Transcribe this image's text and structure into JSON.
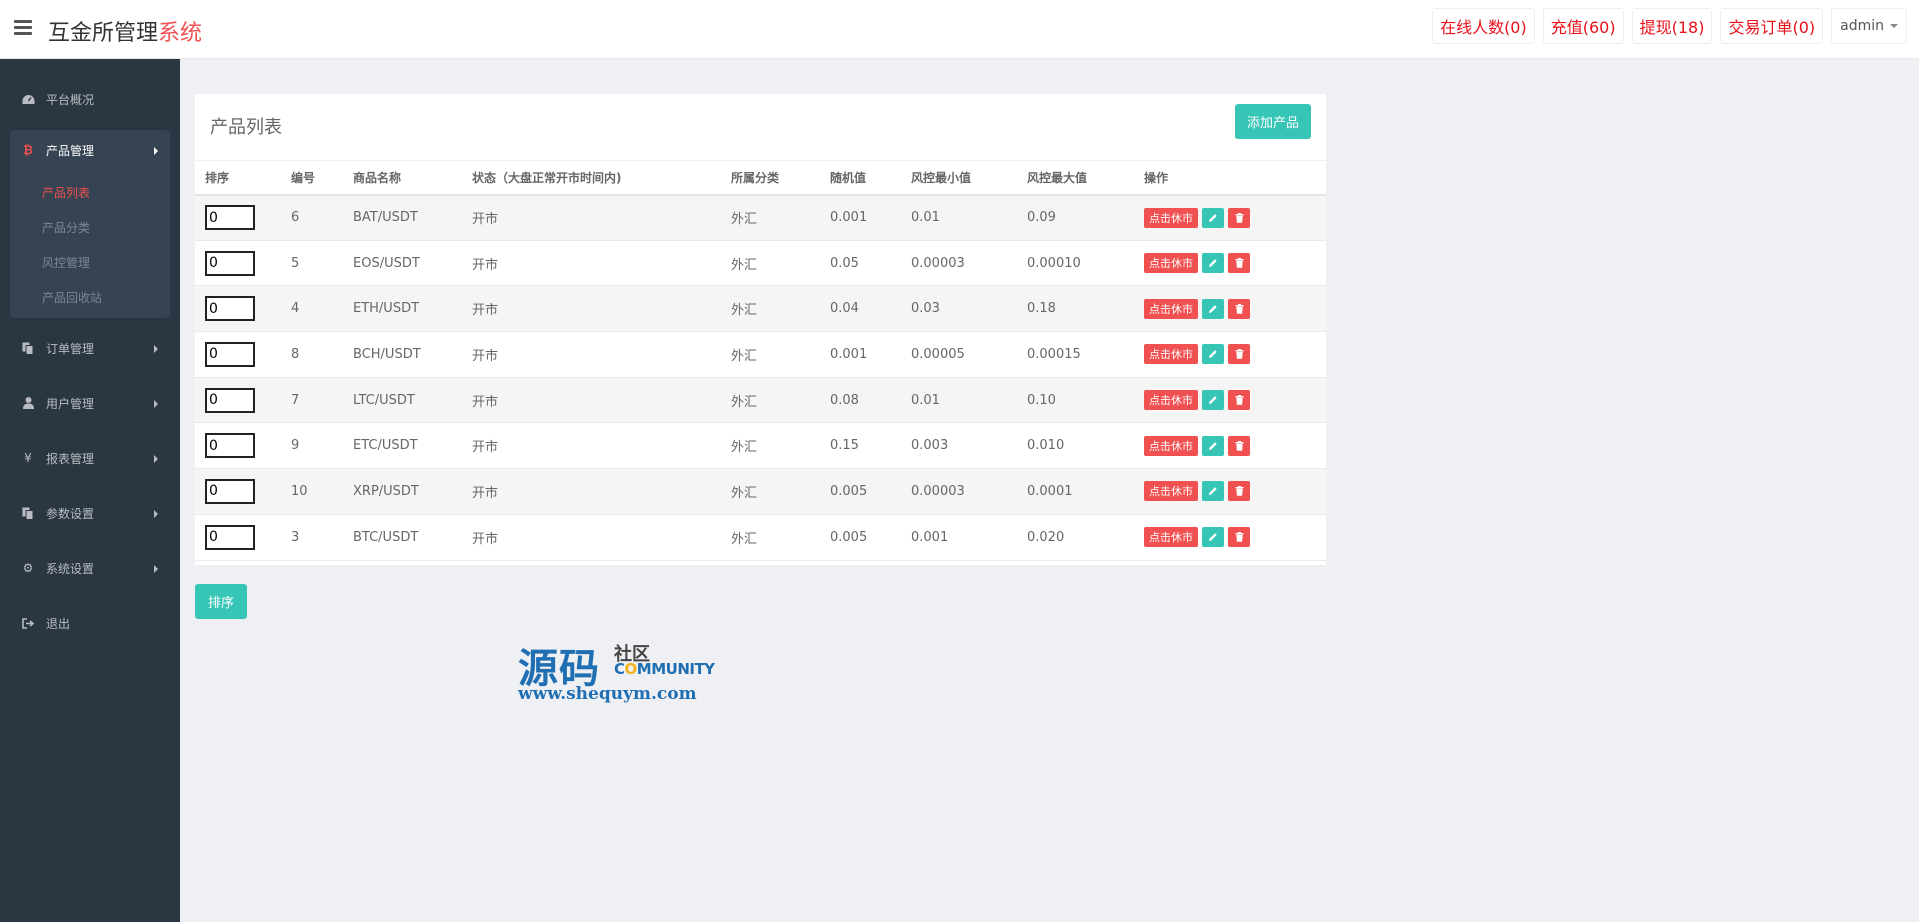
{
  "header": {
    "brand_main": "互金所管理",
    "brand_accent": "系统",
    "buttons": [
      "在线人数(0)",
      "充值(60)",
      "提现(18)",
      "交易订单(0)"
    ],
    "user": "admin"
  },
  "sidebar": {
    "items": [
      {
        "label": "平台概况",
        "icon": "dashboard-icon"
      },
      {
        "label": "产品管理",
        "icon": "bitcoin-icon"
      },
      {
        "label": "订单管理",
        "icon": "copy-icon"
      },
      {
        "label": "用户管理",
        "icon": "user-icon"
      },
      {
        "label": "报表管理",
        "icon": "yen-icon"
      },
      {
        "label": "参数设置",
        "icon": "copy-icon"
      },
      {
        "label": "系统设置",
        "icon": "gears-icon"
      },
      {
        "label": "退出",
        "icon": "sign-out-icon"
      }
    ],
    "sub_items": [
      "产品列表",
      "产品分类",
      "风控管理",
      "产品回收站"
    ]
  },
  "panel": {
    "title": "产品列表",
    "add_button": "添加产品",
    "columns": [
      "排序",
      "编号",
      "商品名称",
      "状态（大盘正常开市时间内)",
      "所属分类",
      "随机值",
      "风控最小值",
      "风控最大值",
      "操作"
    ],
    "rows": [
      {
        "sort": "0",
        "id": "6",
        "name": "BAT/USDT",
        "status": "开市",
        "category": "外汇",
        "random": "0.001",
        "min": "0.01",
        "max": "0.09"
      },
      {
        "sort": "0",
        "id": "5",
        "name": "EOS/USDT",
        "status": "开市",
        "category": "外汇",
        "random": "0.05",
        "min": "0.00003",
        "max": "0.00010"
      },
      {
        "sort": "0",
        "id": "4",
        "name": "ETH/USDT",
        "status": "开市",
        "category": "外汇",
        "random": "0.04",
        "min": "0.03",
        "max": "0.18"
      },
      {
        "sort": "0",
        "id": "8",
        "name": "BCH/USDT",
        "status": "开市",
        "category": "外汇",
        "random": "0.001",
        "min": "0.00005",
        "max": "0.00015"
      },
      {
        "sort": "0",
        "id": "7",
        "name": "LTC/USDT",
        "status": "开市",
        "category": "外汇",
        "random": "0.08",
        "min": "0.01",
        "max": "0.10"
      },
      {
        "sort": "0",
        "id": "9",
        "name": "ETC/USDT",
        "status": "开市",
        "category": "外汇",
        "random": "0.15",
        "min": "0.003",
        "max": "0.010"
      },
      {
        "sort": "0",
        "id": "10",
        "name": "XRP/USDT",
        "status": "开市",
        "category": "外汇",
        "random": "0.005",
        "min": "0.00003",
        "max": "0.0001"
      },
      {
        "sort": "0",
        "id": "3",
        "name": "BTC/USDT",
        "status": "开市",
        "category": "外汇",
        "random": "0.005",
        "min": "0.001",
        "max": "0.020"
      }
    ],
    "row_action": "点击休市",
    "sort_button": "排序"
  },
  "watermark": {
    "big": "源码",
    "small": "社区",
    "community_c": "C",
    "community_o": "O",
    "community_rest": "MMUNITY",
    "url": "www.shequym.com"
  },
  "colors": {
    "accent_red": "#f05050",
    "teal": "#37c6b6",
    "sidebar_bg": "#2b3643"
  }
}
